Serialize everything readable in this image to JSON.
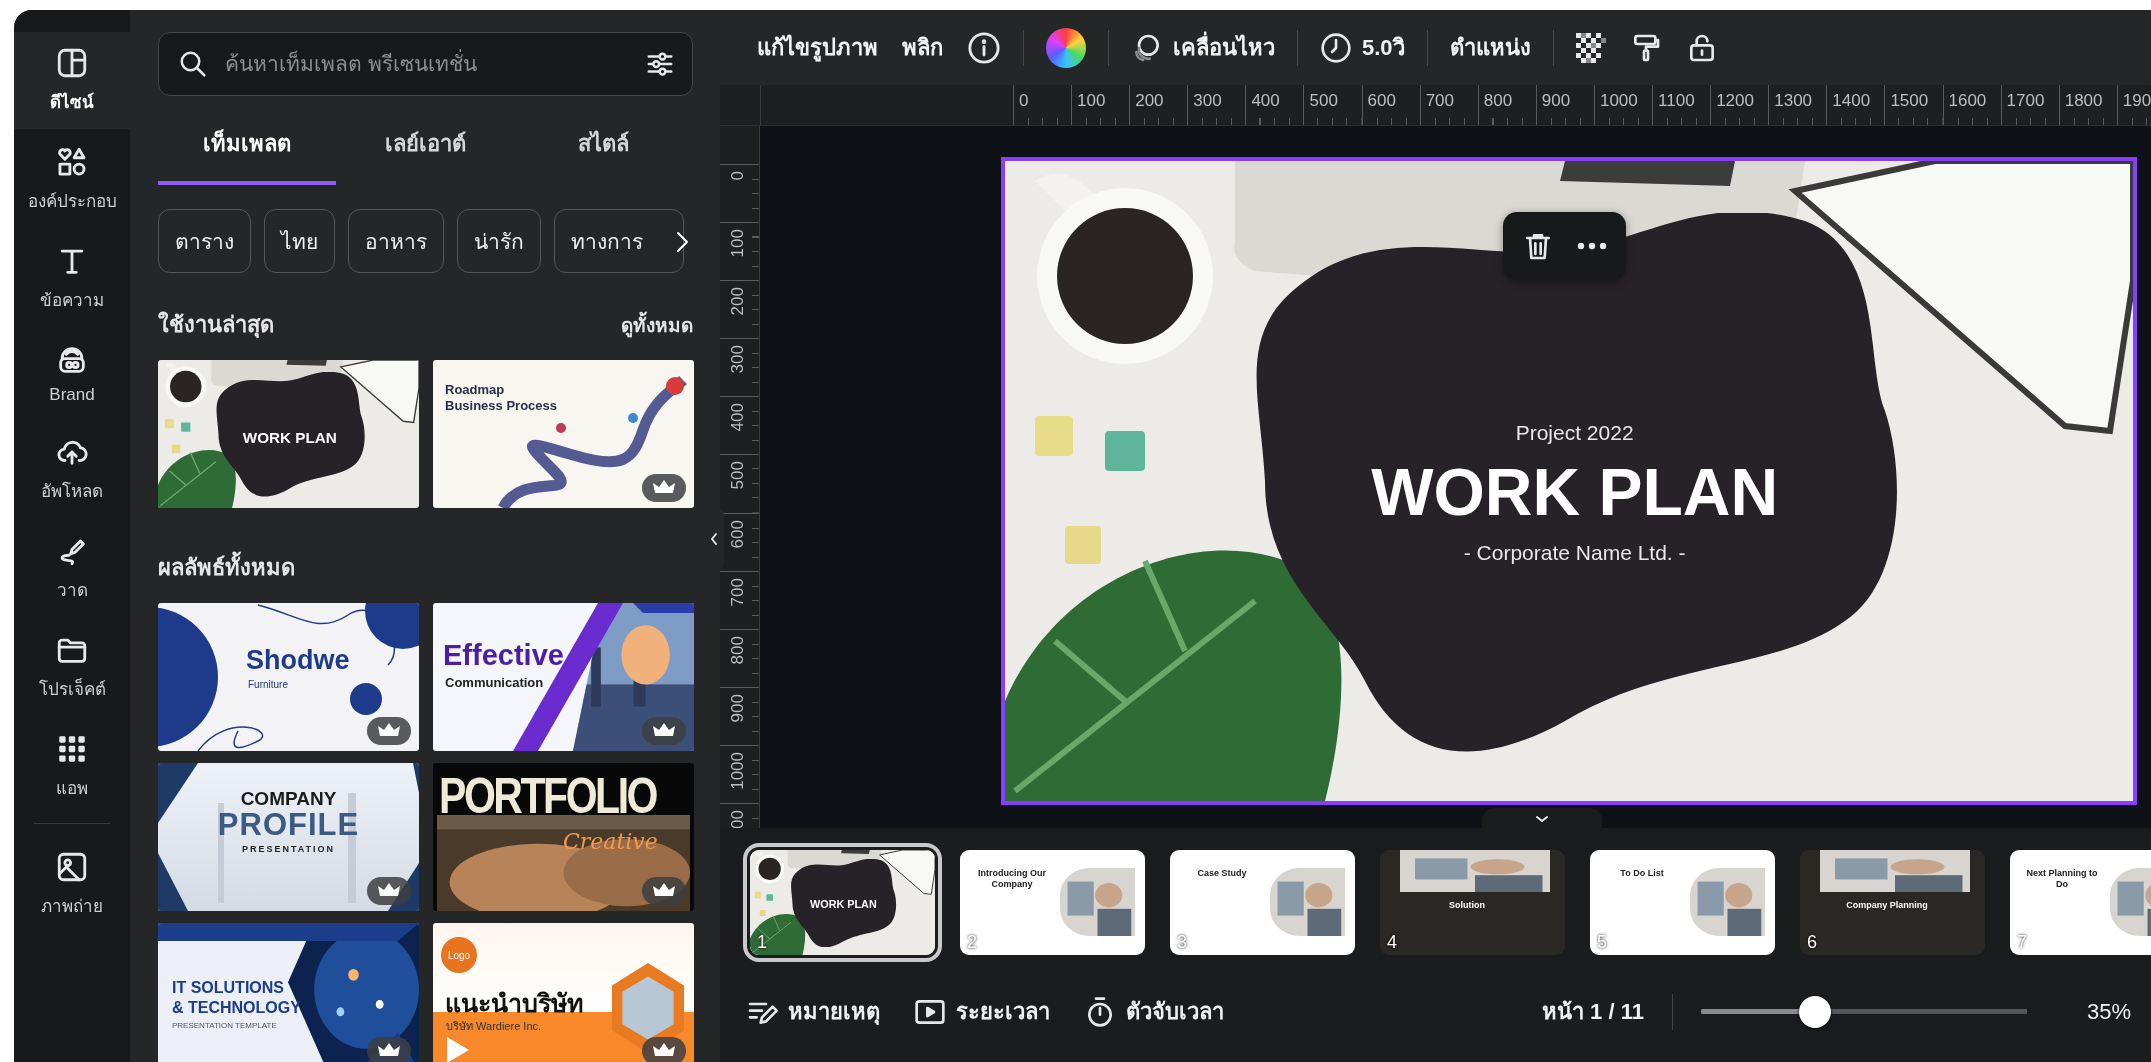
{
  "rail": {
    "items": [
      {
        "kind": "design",
        "label": "ดีไซน์",
        "selected": true
      },
      {
        "kind": "elements",
        "label": "องค์ประกอบ",
        "selected": false
      },
      {
        "kind": "text",
        "label": "ข้อความ",
        "selected": false
      },
      {
        "kind": "brand",
        "label": "Brand",
        "selected": false
      },
      {
        "kind": "uploads",
        "label": "อัพโหลด",
        "selected": false
      },
      {
        "kind": "draw",
        "label": "วาด",
        "selected": false
      },
      {
        "kind": "projects",
        "label": "โปรเจ็คต์",
        "selected": false
      },
      {
        "kind": "apps",
        "label": "แอพ",
        "selected": false
      },
      {
        "kind": "photos",
        "label": "ภาพถ่าย",
        "selected": false
      }
    ]
  },
  "panel": {
    "search": {
      "placeholder": "ค้นหาเท็มเพลต พรีเซนเทชั่น"
    },
    "tabs": [
      {
        "label": "เท็มเพลต",
        "selected": true
      },
      {
        "label": "เลย์เอาต์",
        "selected": false
      },
      {
        "label": "สไตล์",
        "selected": false
      }
    ],
    "chips": [
      "ตาราง",
      "ไทย",
      "อาหาร",
      "น่ารัก",
      "ทางการ"
    ],
    "recent": {
      "title": "ใช้งานล่าสุด",
      "see_all": "ดูทั้งหมด",
      "templates": [
        {
          "kind": "workplan",
          "texts": [
            "WORK PLAN"
          ],
          "premium": false
        },
        {
          "kind": "roadmap",
          "texts": [
            "Roadmap Business Process"
          ],
          "premium": true
        }
      ]
    },
    "results": {
      "title": "ผลลัพธ์ทั้งหมด",
      "templates": [
        {
          "kind": "shodwe",
          "texts": [
            "Shodwe",
            "Furniture"
          ],
          "premium": true
        },
        {
          "kind": "effective",
          "texts": [
            "Effective",
            "Communication"
          ],
          "premium": true
        },
        {
          "kind": "company",
          "texts": [
            "COMPANY",
            "PROFILE",
            "PRESENTATION"
          ],
          "premium": true
        },
        {
          "kind": "portfolio",
          "texts": [
            "PORTFOLIO",
            "Creative"
          ],
          "premium": true
        },
        {
          "kind": "itsolutions",
          "texts": [
            "IT SOLUTIONS",
            "& TECHNOLOGY",
            "PRESENTATION TEMPLATE"
          ],
          "premium": true
        },
        {
          "kind": "thai",
          "texts": [
            "แนะนำบริษัท",
            "บริษัท Wardiere Inc.",
            "Logo"
          ],
          "premium": true
        }
      ]
    }
  },
  "toolbar": {
    "edit_image": "แก้ไขรูปภาพ",
    "flip": "พลิก",
    "animate": "เคลื่อนไหว",
    "duration": "5.0วิ",
    "position": "ตำแหน่ง"
  },
  "ruler": {
    "horizontal": [
      "0",
      "100",
      "200",
      "300",
      "400",
      "500",
      "600",
      "700",
      "800",
      "900",
      "1000",
      "1100",
      "1200",
      "1300",
      "1400",
      "1500",
      "1600",
      "1700",
      "1800",
      "190"
    ],
    "vertical": [
      "0",
      "100",
      "200",
      "300",
      "400",
      "500",
      "600",
      "700",
      "800",
      "900",
      "1000",
      "00"
    ]
  },
  "slide": {
    "selected": true,
    "subtitle": "Project 2022",
    "title": "WORK PLAN",
    "caption": "- Corporate Name Ltd. -"
  },
  "pages": [
    {
      "number": "1",
      "kind": "workplan",
      "title": "WORK PLAN",
      "selected": true
    },
    {
      "number": "2",
      "kind": "light",
      "title": "Introducing Our Company",
      "selected": false
    },
    {
      "number": "3",
      "kind": "light",
      "title": "Case Study",
      "selected": false
    },
    {
      "number": "4",
      "kind": "dark",
      "title": "Solution",
      "selected": false
    },
    {
      "number": "5",
      "kind": "light",
      "title": "To Do List",
      "selected": false
    },
    {
      "number": "6",
      "kind": "dark",
      "title": "Company Planning",
      "selected": false
    },
    {
      "number": "7",
      "kind": "light",
      "title": "Next Planning to Do",
      "selected": false
    }
  ],
  "footer": {
    "notes": "หมายเหตุ",
    "duration": "ระยะเวลา",
    "timer": "ตัวจับเวลา",
    "page_indicator": "หน้า 1 / 11",
    "zoom": {
      "level": 0.35,
      "reading": "35%"
    }
  }
}
